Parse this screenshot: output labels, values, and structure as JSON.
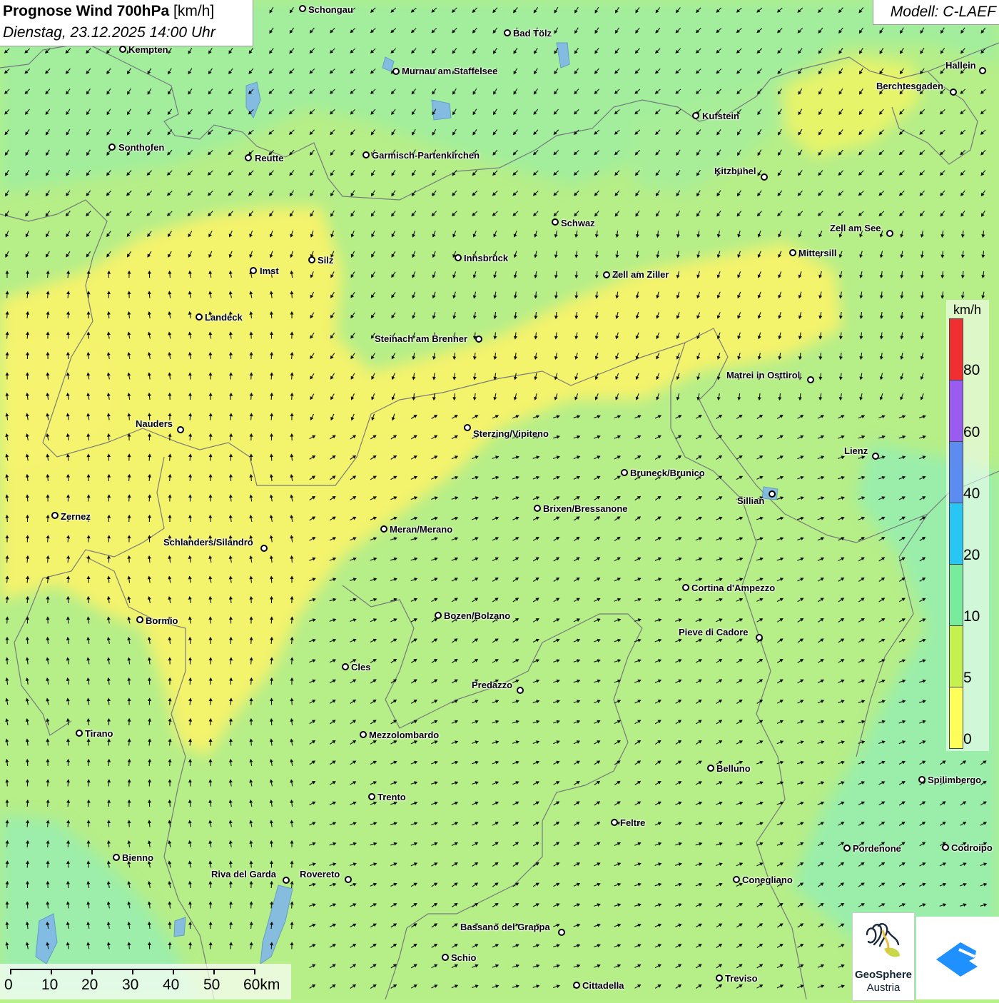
{
  "title": {
    "main": "Prognose Wind 700hPa",
    "unit": " [km/h]",
    "datetime": "Dienstag, 23.12.2025 14:00 Uhr"
  },
  "model_label": "Modell: C-LAEF",
  "legend": {
    "unit": "km/h",
    "ticks": [
      "80",
      "60",
      "40",
      "20",
      "10",
      "5",
      "0"
    ],
    "colors": [
      "#f03030",
      "#9a5cf0",
      "#5c8cf0",
      "#28c6f2",
      "#78ec9c",
      "#c4f050",
      "#ffff5a"
    ]
  },
  "scale_bar": {
    "labels": [
      "0",
      "10",
      "20",
      "30",
      "40",
      "50",
      "60km"
    ]
  },
  "logos": {
    "geosphere_line1": "GeoSphere",
    "geosphere_line2": "Austria"
  },
  "cities": [
    {
      "name": "Schongau"
    },
    {
      "name": "Bad Tölz"
    },
    {
      "name": "Kempten"
    },
    {
      "name": "Murnau am Staffelsee"
    },
    {
      "name": "Hallein"
    },
    {
      "name": "Berchtesgaden"
    },
    {
      "name": "Kufstein"
    },
    {
      "name": "Sonthofen"
    },
    {
      "name": "Reutte"
    },
    {
      "name": "Garmisch-Partenkirchen"
    },
    {
      "name": "Kitzbühel"
    },
    {
      "name": "Schwaz"
    },
    {
      "name": "Zell am See"
    },
    {
      "name": "Mittersill"
    },
    {
      "name": "Silz"
    },
    {
      "name": "Innsbruck"
    },
    {
      "name": "Imst"
    },
    {
      "name": "Zell am Ziller"
    },
    {
      "name": "Landeck"
    },
    {
      "name": "Steinach am Brenner"
    },
    {
      "name": "Matrei in Osttirol"
    },
    {
      "name": "Nauders"
    },
    {
      "name": "Sterzing/Vipiteno"
    },
    {
      "name": "Lienz"
    },
    {
      "name": "Bruneck/Brunico"
    },
    {
      "name": "Sillian"
    },
    {
      "name": "Brixen/Bressanone"
    },
    {
      "name": "Zernez"
    },
    {
      "name": "Meran/Merano"
    },
    {
      "name": "Schlanders/Silandro"
    },
    {
      "name": "Cortina d'Ampezzo"
    },
    {
      "name": "Bozen/Bolzano"
    },
    {
      "name": "Bormio"
    },
    {
      "name": "Pieve di Cadore"
    },
    {
      "name": "Cles"
    },
    {
      "name": "Predazzo"
    },
    {
      "name": "Tirano"
    },
    {
      "name": "Mezzolombardo"
    },
    {
      "name": "Belluno"
    },
    {
      "name": "Spilimbergo"
    },
    {
      "name": "Trento"
    },
    {
      "name": "Feltre"
    },
    {
      "name": "Pordenone"
    },
    {
      "name": "Codroipo"
    },
    {
      "name": "Bienno"
    },
    {
      "name": "Riva del Garda"
    },
    {
      "name": "Rovereto"
    },
    {
      "name": "Conegliano"
    },
    {
      "name": "Bassano del Grappa"
    },
    {
      "name": "Schio"
    },
    {
      "name": "Treviso"
    },
    {
      "name": "Cittadella"
    }
  ]
}
